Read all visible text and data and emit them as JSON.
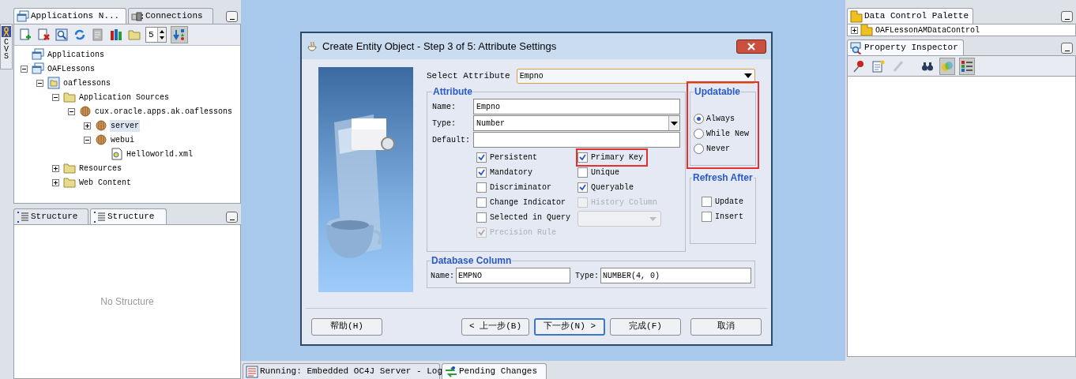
{
  "side_strip": {
    "label": "CVS"
  },
  "navigator": {
    "tabs": [
      {
        "label": "Applications N...",
        "selected": true
      },
      {
        "label": "Connections",
        "selected": false
      }
    ],
    "toolbar_buttons": [
      {
        "pressed": false
      },
      {
        "pressed": false
      },
      {
        "pressed": false
      },
      {
        "pressed": false
      },
      {
        "pressed": false
      },
      {
        "pressed": false
      },
      {
        "pressed": false
      }
    ],
    "spinner": {
      "value": "5"
    },
    "sort_button": {
      "pressed": true
    },
    "tree": [
      {
        "label": "Applications",
        "kind": "workspace",
        "selected": false
      },
      {
        "label": "OAFLessons",
        "kind": "workspace",
        "selected": false,
        "expanded": true,
        "children": [
          {
            "label": "oaflessons",
            "kind": "project",
            "selected": false,
            "expanded": true,
            "children": [
              {
                "label": "Application Sources",
                "kind": "folder",
                "selected": false,
                "expanded": true,
                "children": [
                  {
                    "label": "cux.oracle.apps.ak.oaflessons",
                    "kind": "package",
                    "selected": false,
                    "expanded": true,
                    "children": [
                      {
                        "label": "server",
                        "kind": "package",
                        "selected": true,
                        "expanded": false
                      },
                      {
                        "label": "webui",
                        "kind": "package",
                        "selected": false,
                        "expanded": true,
                        "children": [
                          {
                            "label": "Helloworld.xml",
                            "kind": "xml",
                            "selected": false
                          }
                        ]
                      }
                    ]
                  }
                ]
              },
              {
                "label": "Resources",
                "kind": "folder",
                "selected": false,
                "expanded": false
              },
              {
                "label": "Web Content",
                "kind": "folder",
                "selected": false,
                "expanded": false
              }
            ]
          }
        ]
      }
    ]
  },
  "structure_panel": {
    "tabs": [
      {
        "label": "Structure",
        "selected": false
      },
      {
        "label": "Structure",
        "selected": true
      }
    ],
    "empty_message": "No Structure"
  },
  "dialog": {
    "title": "Create Entity Object - Step 3 of 5: Attribute Settings",
    "select_attribute": {
      "label": "Select Attribute",
      "value": "Empno"
    },
    "attribute": {
      "title": "Attribute",
      "fields": [
        {
          "label": "Name:",
          "value": "Empno",
          "kind": "text"
        },
        {
          "label": "Type:",
          "value": "Number",
          "kind": "dropdown"
        },
        {
          "label": "Default:",
          "kind": "text"
        }
      ],
      "left_checks": [
        {
          "label": "Persistent",
          "checked": true,
          "disabled": false,
          "highlighted": false
        },
        {
          "label": "Mandatory",
          "checked": true,
          "disabled": false,
          "highlighted": false
        },
        {
          "label": "Discriminator",
          "checked": false,
          "disabled": false,
          "highlighted": false
        },
        {
          "label": "Change Indicator",
          "checked": false,
          "disabled": false,
          "highlighted": false
        },
        {
          "label": "Selected in Query",
          "checked": false,
          "disabled": false,
          "highlighted": false
        },
        {
          "label": "Precision Rule",
          "checked": true,
          "disabled": true,
          "highlighted": false
        }
      ],
      "right_checks": [
        {
          "label": "Primary Key",
          "checked": true,
          "disabled": false,
          "highlighted": true
        },
        {
          "label": "Unique",
          "checked": false,
          "disabled": false,
          "highlighted": false
        },
        {
          "label": "Queryable",
          "checked": true,
          "disabled": false,
          "highlighted": false
        },
        {
          "label": "History Column",
          "checked": false,
          "disabled": true,
          "highlighted": false
        }
      ],
      "history_dropdown": {
        "disabled": true
      }
    },
    "updatable": {
      "title": "Updatable",
      "highlighted": true,
      "options": [
        {
          "label": "Always",
          "selected": true
        },
        {
          "label": "While New",
          "selected": false
        },
        {
          "label": "Never",
          "selected": false
        }
      ]
    },
    "refresh_after": {
      "title": "Refresh After",
      "options": [
        {
          "label": "Update",
          "checked": false
        },
        {
          "label": "Insert",
          "checked": false
        }
      ]
    },
    "database_column": {
      "title": "Database Column",
      "name_label": "Name:",
      "name_value": "EMPNO",
      "type_label": "Type:",
      "type_value": "NUMBER(4, 0)"
    },
    "buttons": [
      {
        "label": "帮助(H)",
        "default": false
      },
      {
        "label": "< 上一步(B)",
        "default": false
      },
      {
        "label": "下一步(N) >",
        "default": true
      },
      {
        "label": "完成(F)",
        "default": false
      },
      {
        "label": "取消",
        "default": false
      }
    ]
  },
  "data_control_palette": {
    "title": "Data Control Palette",
    "items": [
      {
        "label": "OAFLessonAMDataControl",
        "expanded": false
      }
    ]
  },
  "property_inspector": {
    "title": "Property Inspector",
    "toolbar_buttons": [
      {
        "pressed": false,
        "disabled": false
      },
      {
        "pressed": false,
        "disabled": false
      },
      {
        "pressed": false,
        "disabled": true
      },
      {
        "pressed": false,
        "disabled": false
      },
      {
        "pressed": true,
        "disabled": false
      },
      {
        "pressed": true,
        "disabled": false
      }
    ]
  },
  "bottom_tabs": [
    {
      "label": "Running: Embedded OC4J Server - Log",
      "selected": false
    },
    {
      "label": "Pending Changes",
      "selected": true
    }
  ]
}
